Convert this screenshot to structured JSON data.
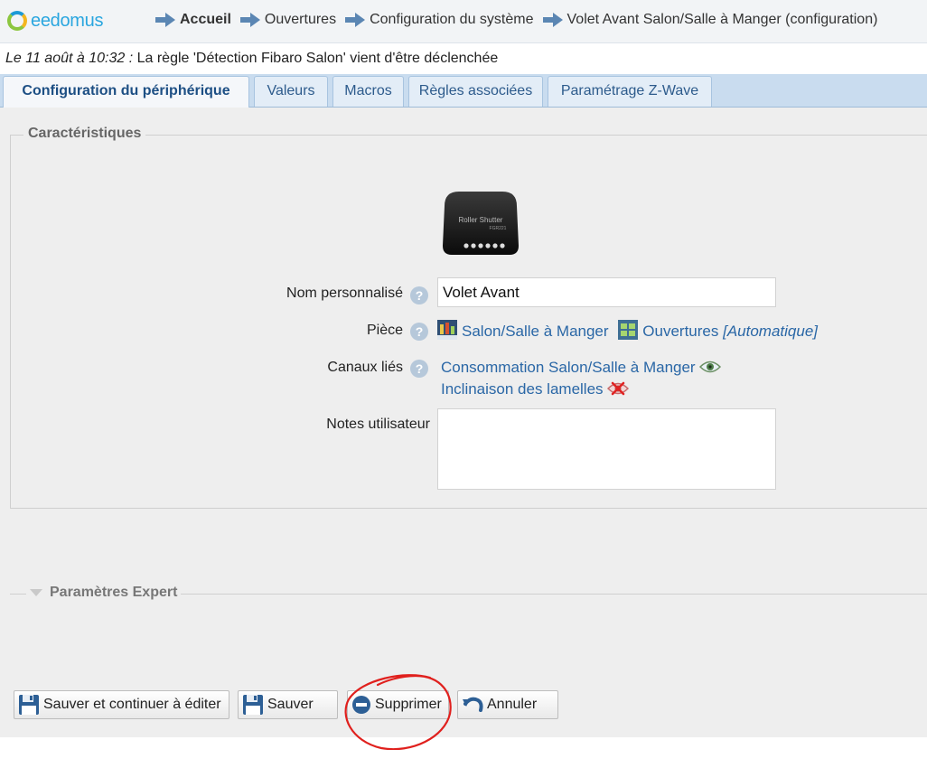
{
  "app": {
    "brand": "eedomus"
  },
  "breadcrumb": [
    "Accueil",
    "Ouvertures",
    "Configuration du système",
    "Volet Avant Salon/Salle à Manger (configuration)"
  ],
  "notice": {
    "when": "Le 11 août à 10:32 :",
    "message": "La règle 'Détection Fibaro Salon' vient d'être déclenchée"
  },
  "tabs": [
    {
      "label": "Configuration du périphérique",
      "active": true
    },
    {
      "label": "Valeurs",
      "active": false
    },
    {
      "label": "Macros",
      "active": false
    },
    {
      "label": "Règles associées",
      "active": false
    },
    {
      "label": "Paramétrage Z-Wave",
      "active": false
    }
  ],
  "characteristics": {
    "legend": "Caractéristiques",
    "device_image": {
      "line1": "Roller Shutter",
      "line2": "FGR221"
    },
    "name_label": "Nom personnalisé",
    "name_value": "Volet Avant",
    "room_label": "Pièce",
    "room_value": "Salon/Salle à Manger",
    "category_value": "Ouvertures",
    "category_mode": "[Automatique]",
    "channels_label": "Canaux liés",
    "channels": [
      {
        "name": "Consommation Salon/Salle à Manger",
        "icon": "eye-icon"
      },
      {
        "name": "Inclinaison des lamelles",
        "icon": "hidden-eye-icon"
      }
    ],
    "notes_label": "Notes utilisateur",
    "notes_value": ""
  },
  "expert": {
    "legend": "Paramètres Expert"
  },
  "buttons": {
    "save_continue": "Sauver et continuer à éditer",
    "save": "Sauver",
    "delete": "Supprimer",
    "cancel": "Annuler"
  },
  "colors": {
    "link": "#2a67a6",
    "tab_bar": "#c9dcef",
    "annotation": "#e0201d"
  }
}
